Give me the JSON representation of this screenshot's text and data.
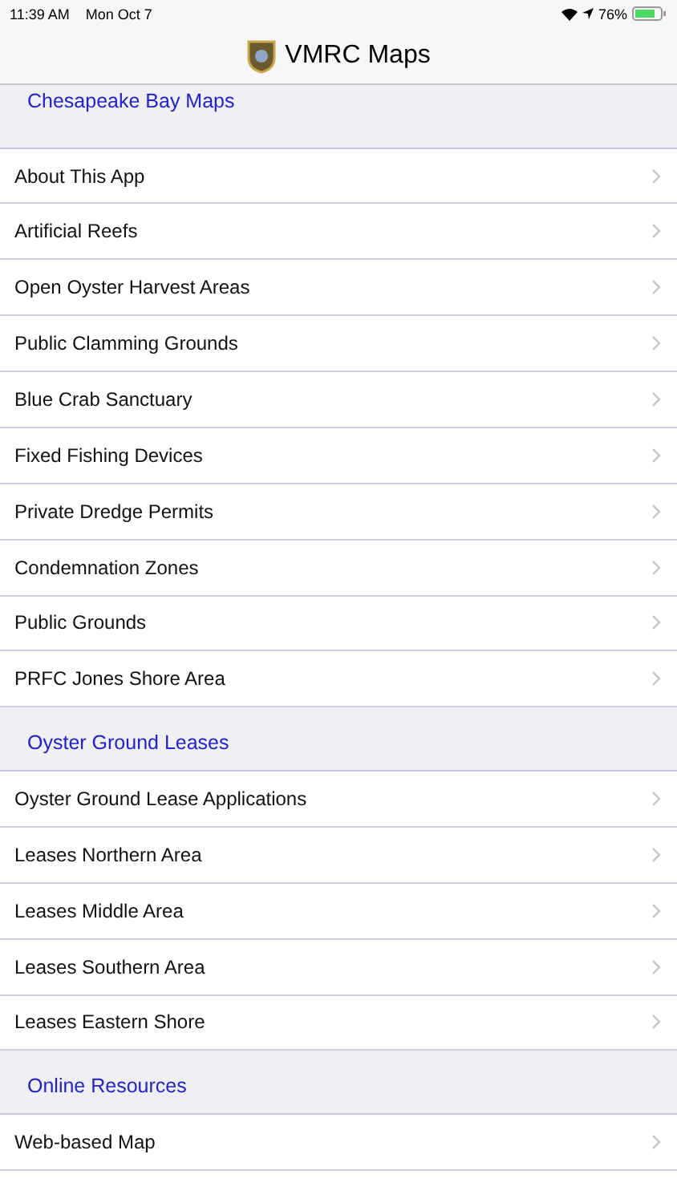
{
  "status_bar": {
    "time": "11:39 AM",
    "date": "Mon Oct 7",
    "battery": "76%"
  },
  "nav": {
    "title": "VMRC Maps"
  },
  "sections": [
    {
      "title": "Chesapeake Bay Maps",
      "items": [
        "About This App",
        "Artificial Reefs",
        "Open Oyster Harvest Areas",
        "Public Clamming Grounds",
        "Blue Crab Sanctuary",
        "Fixed Fishing Devices",
        "Private Dredge Permits",
        "Condemnation Zones",
        "Public Grounds",
        "PRFC Jones Shore Area"
      ]
    },
    {
      "title": "Oyster Ground Leases",
      "items": [
        "Oyster Ground Lease Applications",
        "Leases Northern Area",
        "Leases Middle Area",
        "Leases Southern Area",
        "Leases Eastern Shore"
      ]
    },
    {
      "title": "Online Resources",
      "items": [
        "Web-based Map"
      ]
    }
  ]
}
